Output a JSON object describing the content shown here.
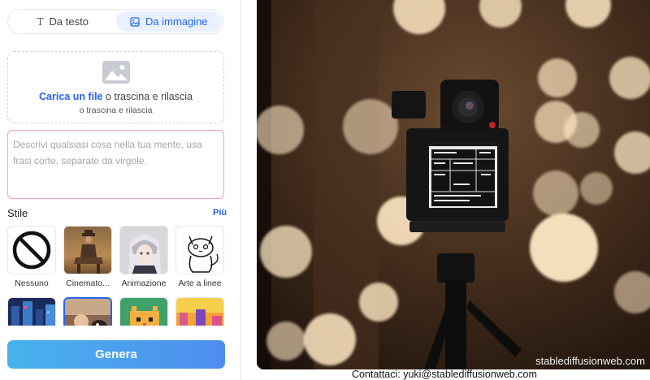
{
  "tabs": [
    {
      "label": "Da testo",
      "icon": "text-icon",
      "active": false
    },
    {
      "label": "Da immagine",
      "icon": "image-icon",
      "active": true
    }
  ],
  "upload": {
    "link_text": "Carica un file",
    "drag_text": "o trascina e rilascia",
    "sub_text": "o trascina e rilascia",
    "icon": "image-placeholder-icon"
  },
  "prompt": {
    "value": "",
    "placeholder": "Descrivi qualsiasi cosa nella tua mente, usa frasi corte, separate da virgole."
  },
  "styles": {
    "title": "Stile",
    "more_label": "Più",
    "items": [
      {
        "label": "Nessuno",
        "icon": "none-icon"
      },
      {
        "label": "Cinemato...",
        "icon": "cinematic-thumbnail"
      },
      {
        "label": "Animazione",
        "icon": "anime-thumbnail"
      },
      {
        "label": "Arte a linee",
        "icon": "line-art-cat-thumbnail"
      },
      {
        "label": "",
        "icon": "cyberpunk-city-thumbnail"
      },
      {
        "label": "",
        "icon": "photo-thumbnail"
      },
      {
        "label": "",
        "icon": "pixel-cat-thumbnail"
      },
      {
        "label": "",
        "icon": "pixel-city-thumbnail"
      }
    ],
    "selected_index": 5
  },
  "generate_button": {
    "label": "Genera"
  },
  "preview": {
    "icon": "camera-on-tripod-bokeh-image"
  },
  "watermark": "stablediffusionweb.com",
  "contact": "Contattaci: yuki@stablediffusionweb.com",
  "colors": {
    "accent": "#2563eb",
    "active_tab_bg": "#e8f1fd",
    "prompt_border": "#f0a6b0",
    "button_start": "#48b3ec",
    "button_end": "#4f8df0"
  }
}
